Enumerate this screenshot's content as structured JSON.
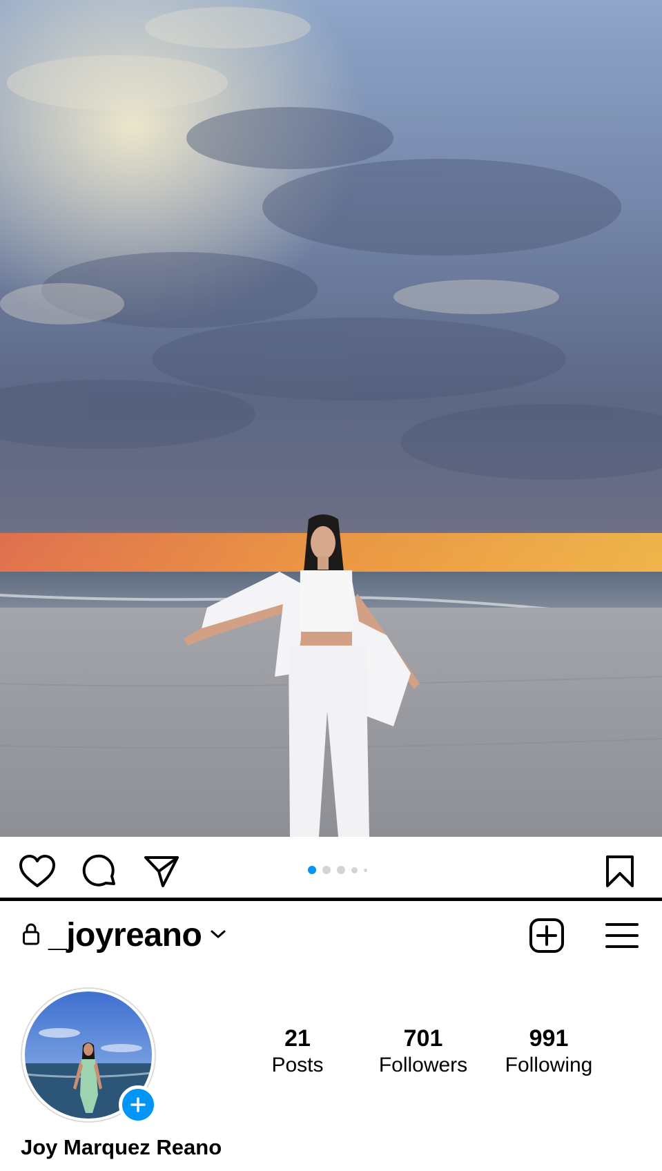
{
  "post": {
    "carousel": {
      "total": 5,
      "active_index": 0
    },
    "actions": {
      "like_icon": "heart-icon",
      "comment_icon": "comment-bubble-icon",
      "share_icon": "paper-plane-icon",
      "save_icon": "bookmark-icon"
    }
  },
  "profile": {
    "username": "_joyreano",
    "private_icon": "lock-icon",
    "full_name": "Joy Marquez Reano",
    "stats": {
      "posts": {
        "value": "21",
        "label": "Posts"
      },
      "followers": {
        "value": "701",
        "label": "Followers"
      },
      "following": {
        "value": "991",
        "label": "Following"
      }
    }
  },
  "colors": {
    "accent": "#0095f6",
    "inactive_dot": "#d4d4d4",
    "text": "#000000"
  }
}
